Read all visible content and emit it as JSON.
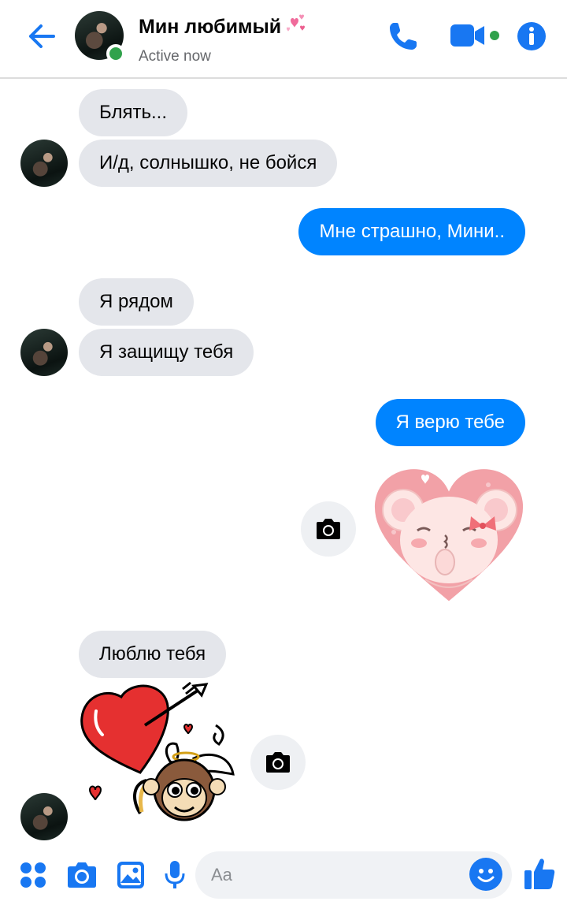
{
  "accent_color": "#0084ff",
  "header": {
    "contact_name": "Мин любимый",
    "status": "Active now",
    "icons": [
      "back-arrow-icon",
      "phone-icon",
      "video-camera-icon",
      "info-icon"
    ]
  },
  "messages": [
    {
      "side": "in",
      "text": "Блять..."
    },
    {
      "side": "in",
      "text": "И/д, солнышко, не бойся"
    },
    {
      "side": "out",
      "text": "Мне страшно, Мини.."
    },
    {
      "side": "in",
      "text": "Я рядом"
    },
    {
      "side": "in",
      "text": "Я защищу тебя"
    },
    {
      "side": "out",
      "text": "Я верю тебе"
    },
    {
      "side": "out",
      "type": "sticker",
      "sticker": "koala-heart-sticker"
    },
    {
      "side": "in",
      "text": "Люблю тебя"
    },
    {
      "side": "in",
      "type": "sticker",
      "sticker": "cupid-monkey-heart-sticker"
    }
  ],
  "composer": {
    "placeholder": "Aa",
    "icons": [
      "apps-grid-icon",
      "camera-icon",
      "gallery-icon",
      "microphone-icon",
      "emoji-icon",
      "thumbs-up-icon"
    ]
  }
}
